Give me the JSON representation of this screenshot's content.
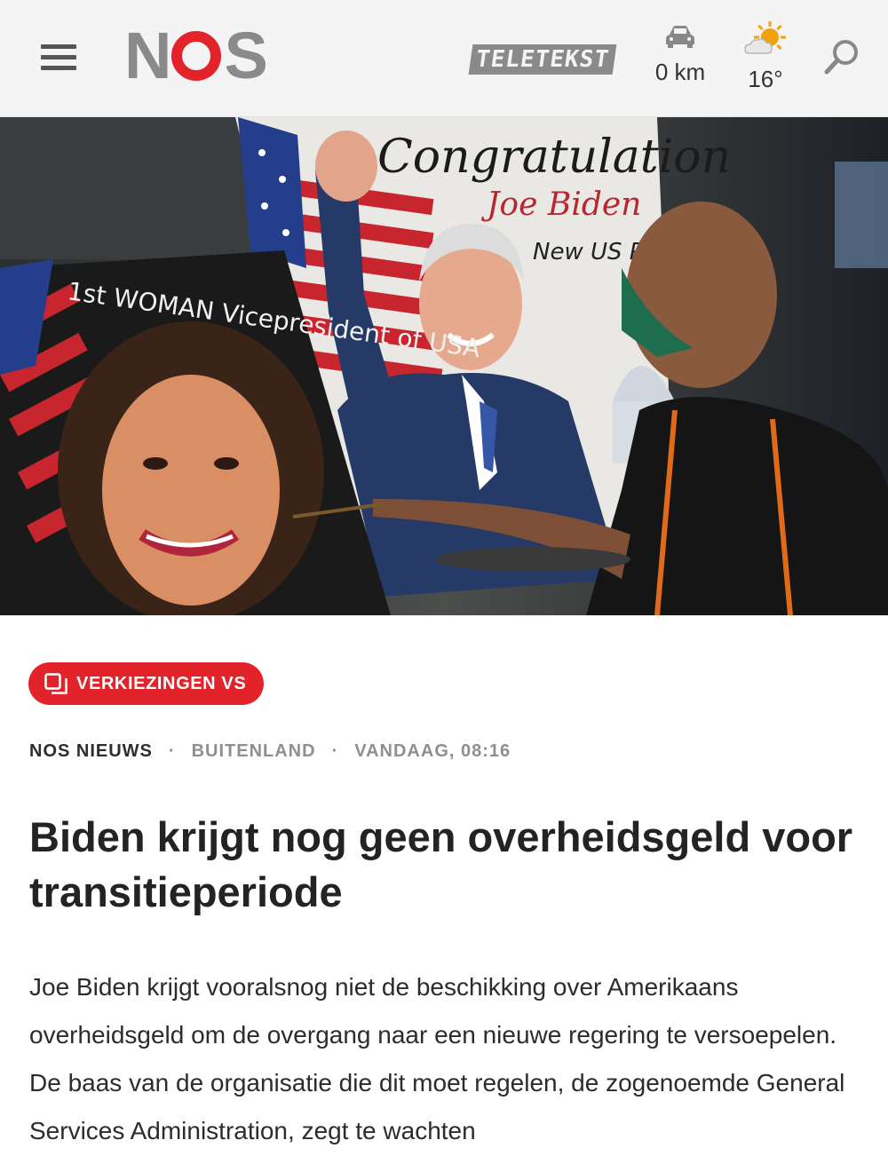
{
  "header": {
    "logo": "NOS",
    "teletekst_label": "TELETEKST",
    "traffic_value": "0 km",
    "weather_value": "16°"
  },
  "hero": {
    "painting_left_text": "1st WOMAN Vicepresident of USA",
    "painting_right_title": "Congratulation",
    "painting_right_name": "Joe Biden",
    "painting_right_sub": "New US Pre..."
  },
  "article": {
    "tag_label": "VERKIEZINGEN VS",
    "meta_source": "NOS NIEUWS",
    "meta_section": "BUITENLAND",
    "meta_time": "VANDAAG, 08:16",
    "title": "Biden krijgt nog geen overheidsgeld voor transitieperiode",
    "lead": "Joe Biden krijgt vooralsnog niet de beschikking over Amerikaans overheidsgeld om de overgang naar een nieuwe regering te versoepelen. De baas van de organisatie die dit moet regelen, de zogenoemde General Services Administration, zegt te wachten"
  },
  "colors": {
    "accent": "#e2232a",
    "header_bg": "#f4f4f4",
    "logo_grey": "#8a8a8a"
  },
  "icons": [
    "menu-icon",
    "car-icon",
    "weather-sun-cloud-icon",
    "search-icon",
    "collection-icon"
  ]
}
